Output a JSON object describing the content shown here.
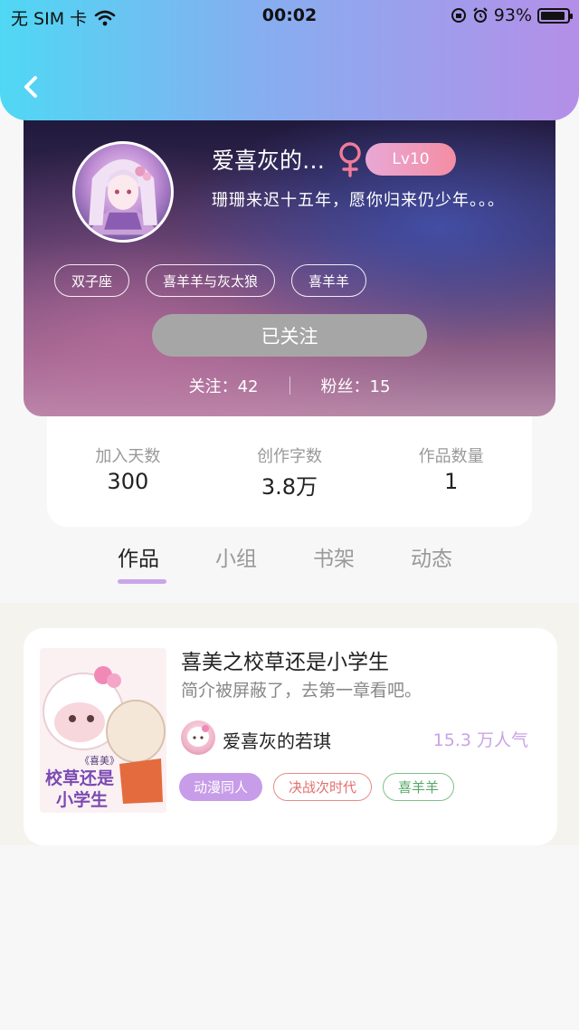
{
  "status_bar": {
    "carrier": "无 SIM 卡",
    "time": "00:02",
    "battery_percent": "93%",
    "battery_level": 0.93
  },
  "profile": {
    "nickname": "爱喜灰的…",
    "level": "Lv10",
    "signature": "珊珊来迟十五年，愿你归来仍少年。。。",
    "tags": [
      "双子座",
      "喜羊羊与灰太狼",
      "喜羊羊"
    ],
    "follow_button": "已关注",
    "following": "关注：42",
    "fans": "粉丝：15"
  },
  "stats": [
    {
      "label": "加入天数",
      "value": "300"
    },
    {
      "label": "创作字数",
      "value": "3.8万"
    },
    {
      "label": "作品数量",
      "value": "1"
    }
  ],
  "tabs": [
    "作品",
    "小组",
    "书架",
    "动态"
  ],
  "works": [
    {
      "title": "喜美之校草还是小学生",
      "intro": "简介被屏蔽了，去第一章看吧。",
      "author": "爱喜灰的若琪",
      "popularity": "15.3 万人气",
      "tags": [
        "动漫同人",
        "决战次时代",
        "喜羊羊"
      ],
      "cover_text": {
        "top": "《喜美》",
        "line1": "校草还是",
        "line2": "小学生"
      }
    }
  ],
  "colors": {
    "header_gradient": [
      "#4fd8f4",
      "#86aef0",
      "#b48fe8"
    ],
    "accent": "#c9a7ea",
    "level_badge": "#f48da3"
  }
}
